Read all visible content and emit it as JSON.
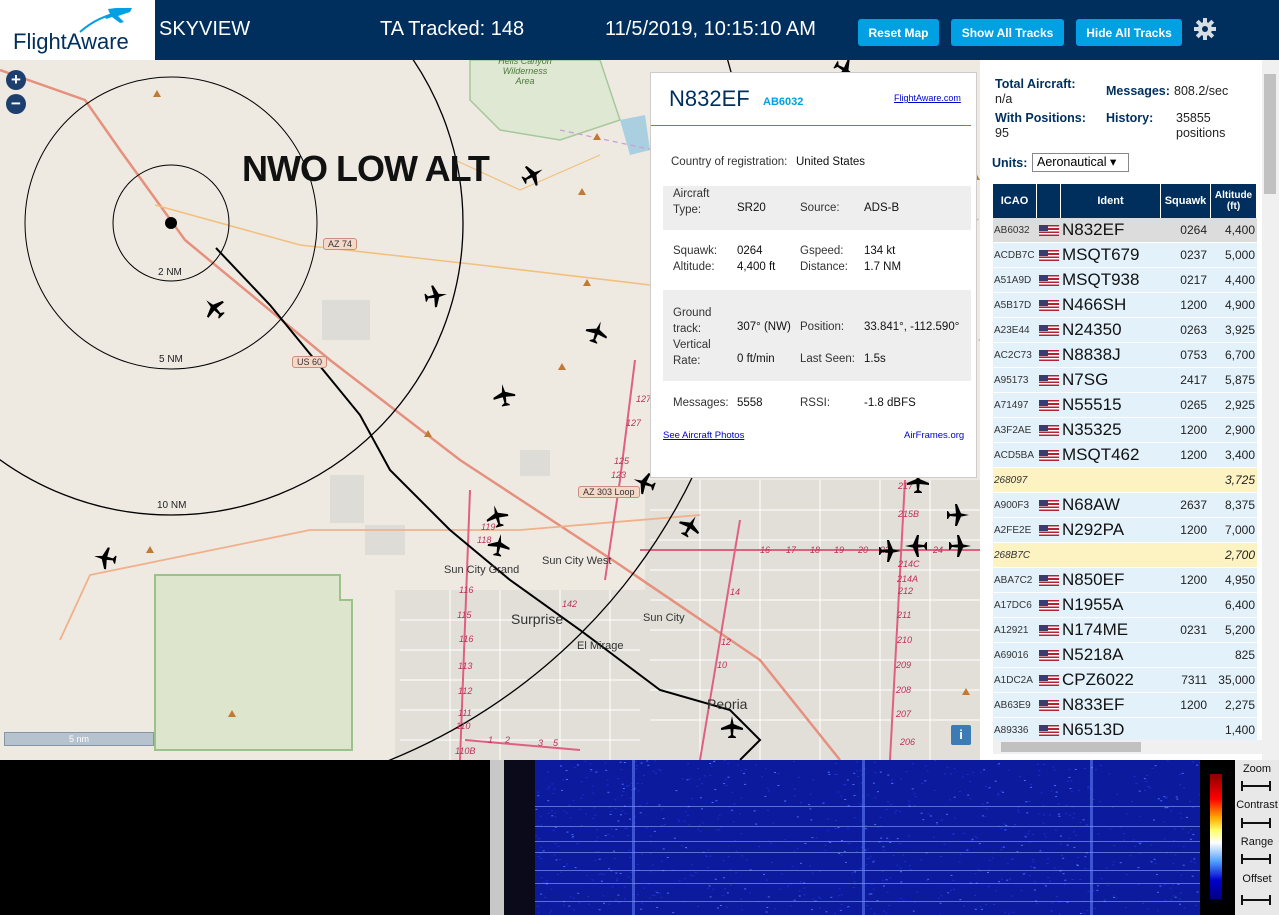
{
  "header": {
    "logo_text": "FlightAware",
    "app_name": "SKYVIEW",
    "tracked": "TA Tracked: 148",
    "datetime": "11/5/2019, 10:15:10 AM",
    "buttons": {
      "reset": "Reset Map",
      "show": "Show All Tracks",
      "hide": "Hide All Tracks"
    },
    "settings_icon": "gear-icon",
    "colors": {
      "bar": "#002f5d",
      "button": "#00a0e2"
    }
  },
  "map": {
    "zoom_in": "+",
    "zoom_out": "−",
    "overlay_label": "NWO LOW ALT",
    "ring_labels": [
      "2 NM",
      "5 NM",
      "10 NM"
    ],
    "area_label": "Hells Canyon\nWilderness\nArea",
    "route_labels": {
      "az74": "AZ 74",
      "us60": "US 60",
      "az303": "AZ 303 Loop"
    },
    "cities": {
      "sun_city_grand": "Sun City Grand",
      "sun_city_west": "Sun City West",
      "surprise": "Surprise",
      "sun_city": "Sun City",
      "el_mirage": "El Mirage",
      "peoria": "Peoria"
    },
    "road_numbers": [
      "127",
      "125",
      "123",
      "119",
      "118",
      "116",
      "115",
      "113",
      "112",
      "111",
      "110",
      "110B",
      "142",
      "14",
      "12",
      "10",
      "217",
      "215B",
      "214C",
      "214A",
      "212",
      "211",
      "210",
      "209",
      "208",
      "207",
      "206",
      "16",
      "17",
      "18",
      "19",
      "20",
      "22",
      "24",
      "1",
      "2",
      "3",
      "5"
    ],
    "scale": "5 nm",
    "info": "i"
  },
  "popup": {
    "callsign": "N832EF",
    "icao": "AB6032",
    "link": "FlightAware.com",
    "country_label": "Country of registration:",
    "country": "United States",
    "aircraft_type_label": "Aircraft Type:",
    "aircraft_type": "SR20",
    "source_label": "Source:",
    "source": "ADS-B",
    "squawk_label": "Squawk:",
    "squawk": "0264",
    "altitude_label": "Altitude:",
    "altitude": "4,400 ft",
    "gspeed_label": "Gspeed:",
    "gspeed": "134 kt",
    "distance_label": "Distance:",
    "distance": "1.7 NM",
    "track_label": "Ground track:",
    "track": "307° (NW)",
    "position_label": "Position:",
    "position": "33.841°, -112.590°",
    "vrate_label": "Vertical Rate:",
    "vrate": "0 ft/min",
    "lastseen_label": "Last Seen:",
    "lastseen": "1.5s",
    "messages_label": "Messages:",
    "messages": "5558",
    "rssi_label": "RSSI:",
    "rssi": "-1.8 dBFS",
    "photos_link": "See Aircraft Photos",
    "airframes_link": "AirFrames.org"
  },
  "sidebar": {
    "total_label": "Total Aircraft:",
    "total": "n/a",
    "messages_label": "Messages:",
    "messages": "808.2/sec",
    "positions_label": "With Positions:",
    "positions": "95",
    "history_label": "History:",
    "history": "35855 positions",
    "units_label": "Units:",
    "units": "Aeronautical ▾",
    "columns": [
      "ICAO",
      "",
      "Ident",
      "Squawk",
      "Altitude (ft)"
    ],
    "rows": [
      {
        "icao": "AB6032",
        "ident": "N832EF",
        "squawk": "0264",
        "alt": "4,400",
        "style": "sel"
      },
      {
        "icao": "ACDB7C",
        "ident": "MSQT679",
        "squawk": "0237",
        "alt": "5,000",
        "style": "blue"
      },
      {
        "icao": "A51A9D",
        "ident": "MSQT938",
        "squawk": "0217",
        "alt": "4,400",
        "style": "blue"
      },
      {
        "icao": "A5B17D",
        "ident": "N466SH",
        "squawk": "1200",
        "alt": "4,900",
        "style": "blue"
      },
      {
        "icao": "A23E44",
        "ident": "N24350",
        "squawk": "0263",
        "alt": "3,925",
        "style": "blue"
      },
      {
        "icao": "AC2C73",
        "ident": "N8838J",
        "squawk": "0753",
        "alt": "6,700",
        "style": "blue"
      },
      {
        "icao": "A95173",
        "ident": "N7SG",
        "squawk": "2417",
        "alt": "5,875",
        "style": "blue"
      },
      {
        "icao": "A71497",
        "ident": "N55515",
        "squawk": "0265",
        "alt": "2,925",
        "style": "blue"
      },
      {
        "icao": "A3F2AE",
        "ident": "N35325",
        "squawk": "1200",
        "alt": "2,900",
        "style": "blue"
      },
      {
        "icao": "ACD5BA",
        "ident": "MSQT462",
        "squawk": "1200",
        "alt": "3,400",
        "style": "blue"
      },
      {
        "icao": "268097",
        "ident": "",
        "squawk": "",
        "alt": "3,725",
        "style": "yellow"
      },
      {
        "icao": "A900F3",
        "ident": "N68AW",
        "squawk": "2637",
        "alt": "8,375",
        "style": "blue"
      },
      {
        "icao": "A2FE2E",
        "ident": "N292PA",
        "squawk": "1200",
        "alt": "7,000",
        "style": "blue"
      },
      {
        "icao": "268B7C",
        "ident": "",
        "squawk": "",
        "alt": "2,700",
        "style": "yellow"
      },
      {
        "icao": "ABA7C2",
        "ident": "N850EF",
        "squawk": "1200",
        "alt": "4,950",
        "style": "blue"
      },
      {
        "icao": "A17DC6",
        "ident": "N1955A",
        "squawk": "",
        "alt": "6,400",
        "style": "blue"
      },
      {
        "icao": "A12921",
        "ident": "N174ME",
        "squawk": "0231",
        "alt": "5,200",
        "style": "blue"
      },
      {
        "icao": "A69016",
        "ident": "N5218A",
        "squawk": "",
        "alt": "825",
        "style": "blue"
      },
      {
        "icao": "A1DC2A",
        "ident": "CPZ6022",
        "squawk": "7311",
        "alt": "35,000",
        "style": "blue"
      },
      {
        "icao": "AB63E9",
        "ident": "N833EF",
        "squawk": "1200",
        "alt": "2,275",
        "style": "blue"
      },
      {
        "icao": "A89336",
        "ident": "N6513D",
        "squawk": "",
        "alt": "1,400",
        "style": "blue"
      }
    ]
  },
  "spectrum": {
    "controls": {
      "zoom": "Zoom",
      "contrast": "Contrast",
      "range": "Range",
      "offset": "Offset"
    }
  }
}
